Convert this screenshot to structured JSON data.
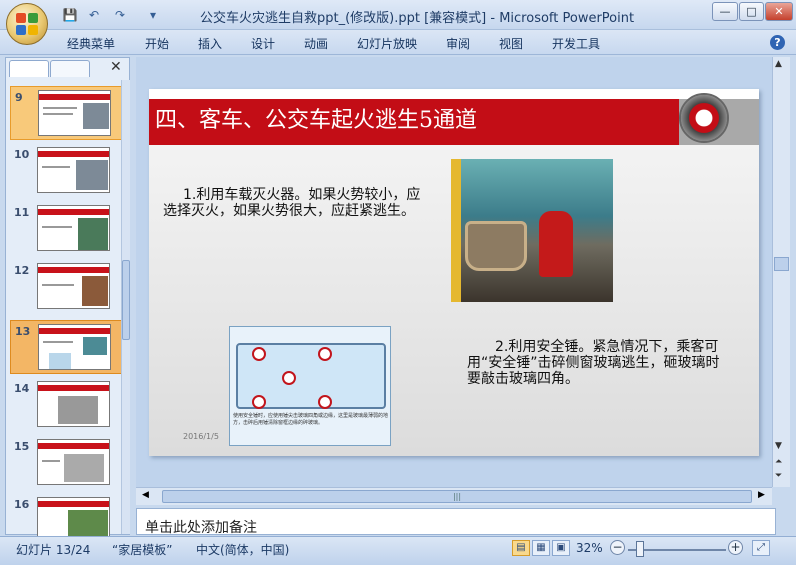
{
  "window": {
    "title": "公交车火灾逃生自救ppt_(修改版).ppt [兼容模式] - Microsoft PowerPoint",
    "minimize": "—",
    "maximize": "□",
    "close": "✕"
  },
  "qat": {
    "save": "💾",
    "undo": "↶",
    "redo": "↷",
    "more": "▾"
  },
  "ribbon": {
    "tabs": [
      "经典菜单",
      "开始",
      "插入",
      "设计",
      "动画",
      "幻灯片放映",
      "审阅",
      "视图",
      "开发工具"
    ],
    "help": "?"
  },
  "panel": {
    "close": "✕",
    "thumbnails": [
      {
        "num": "9"
      },
      {
        "num": "10"
      },
      {
        "num": "11"
      },
      {
        "num": "12"
      },
      {
        "num": "13"
      },
      {
        "num": "14"
      },
      {
        "num": "15"
      },
      {
        "num": "16"
      }
    ]
  },
  "slide": {
    "title": "四、客车、公交车起火逃生5通道",
    "text1": "1.利用车载灭火器。如果火势较小，应选择灭火，如果火势很大，应赶紧逃生。",
    "text2": "2.利用安全锤。紧急情况下，乘客可用“安全锤”击碎侧窗玻璃逃生，砸玻璃时要敲击玻璃四角。",
    "illus_caption": "使用安全锤时，应使用锤尖击玻璃四角或边缘，这里是玻璃最薄弱的地方，击碎后用锤清除窗框边缘的碎玻璃。",
    "date": "2016/1/5"
  },
  "notes": {
    "placeholder": "单击此处添加备注"
  },
  "status": {
    "slide": "幻灯片 13/24",
    "theme": "“家居模板”",
    "lang": "中文(简体，中国)",
    "zoom": "32%",
    "zoom_minus": "−",
    "zoom_plus": "+"
  },
  "colors": {
    "accent": "#c30d16",
    "selected_thumb": "#f8c97a"
  }
}
